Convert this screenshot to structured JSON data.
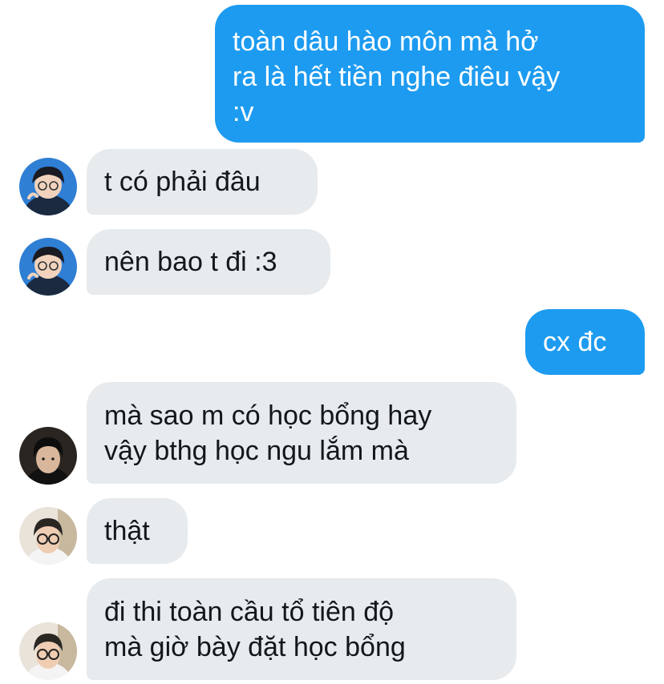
{
  "conversation": {
    "messages": [
      {
        "sender": "me",
        "text": "toàn dâu hào môn mà hở\nra là hết tiền nghe điêu vậy\n:v"
      },
      {
        "sender": "other",
        "avatar": "avatar-boy-glasses-icon",
        "text": "t có phải đâu"
      },
      {
        "sender": "other",
        "avatar": "avatar-boy-glasses-icon",
        "text": "nên bao t đi :3"
      },
      {
        "sender": "me",
        "text": "cx đc"
      },
      {
        "sender": "other",
        "avatar": "avatar-boy-dark-icon",
        "text": "mà sao m có học bổng hay\nvậy bthg học ngu lắm mà"
      },
      {
        "sender": "other",
        "avatar": "avatar-boy-round-glasses-icon",
        "text": "thật"
      },
      {
        "sender": "other",
        "avatar": "avatar-boy-round-glasses-icon",
        "text": "đi thi toàn cầu tổ tiên độ\nmà giờ bày đặt học bổng"
      }
    ]
  },
  "colors": {
    "outgoing_bubble": "#1d9bf0",
    "incoming_bubble": "#e7ebee",
    "outgoing_text": "#ffffff",
    "incoming_text": "#14171a"
  }
}
